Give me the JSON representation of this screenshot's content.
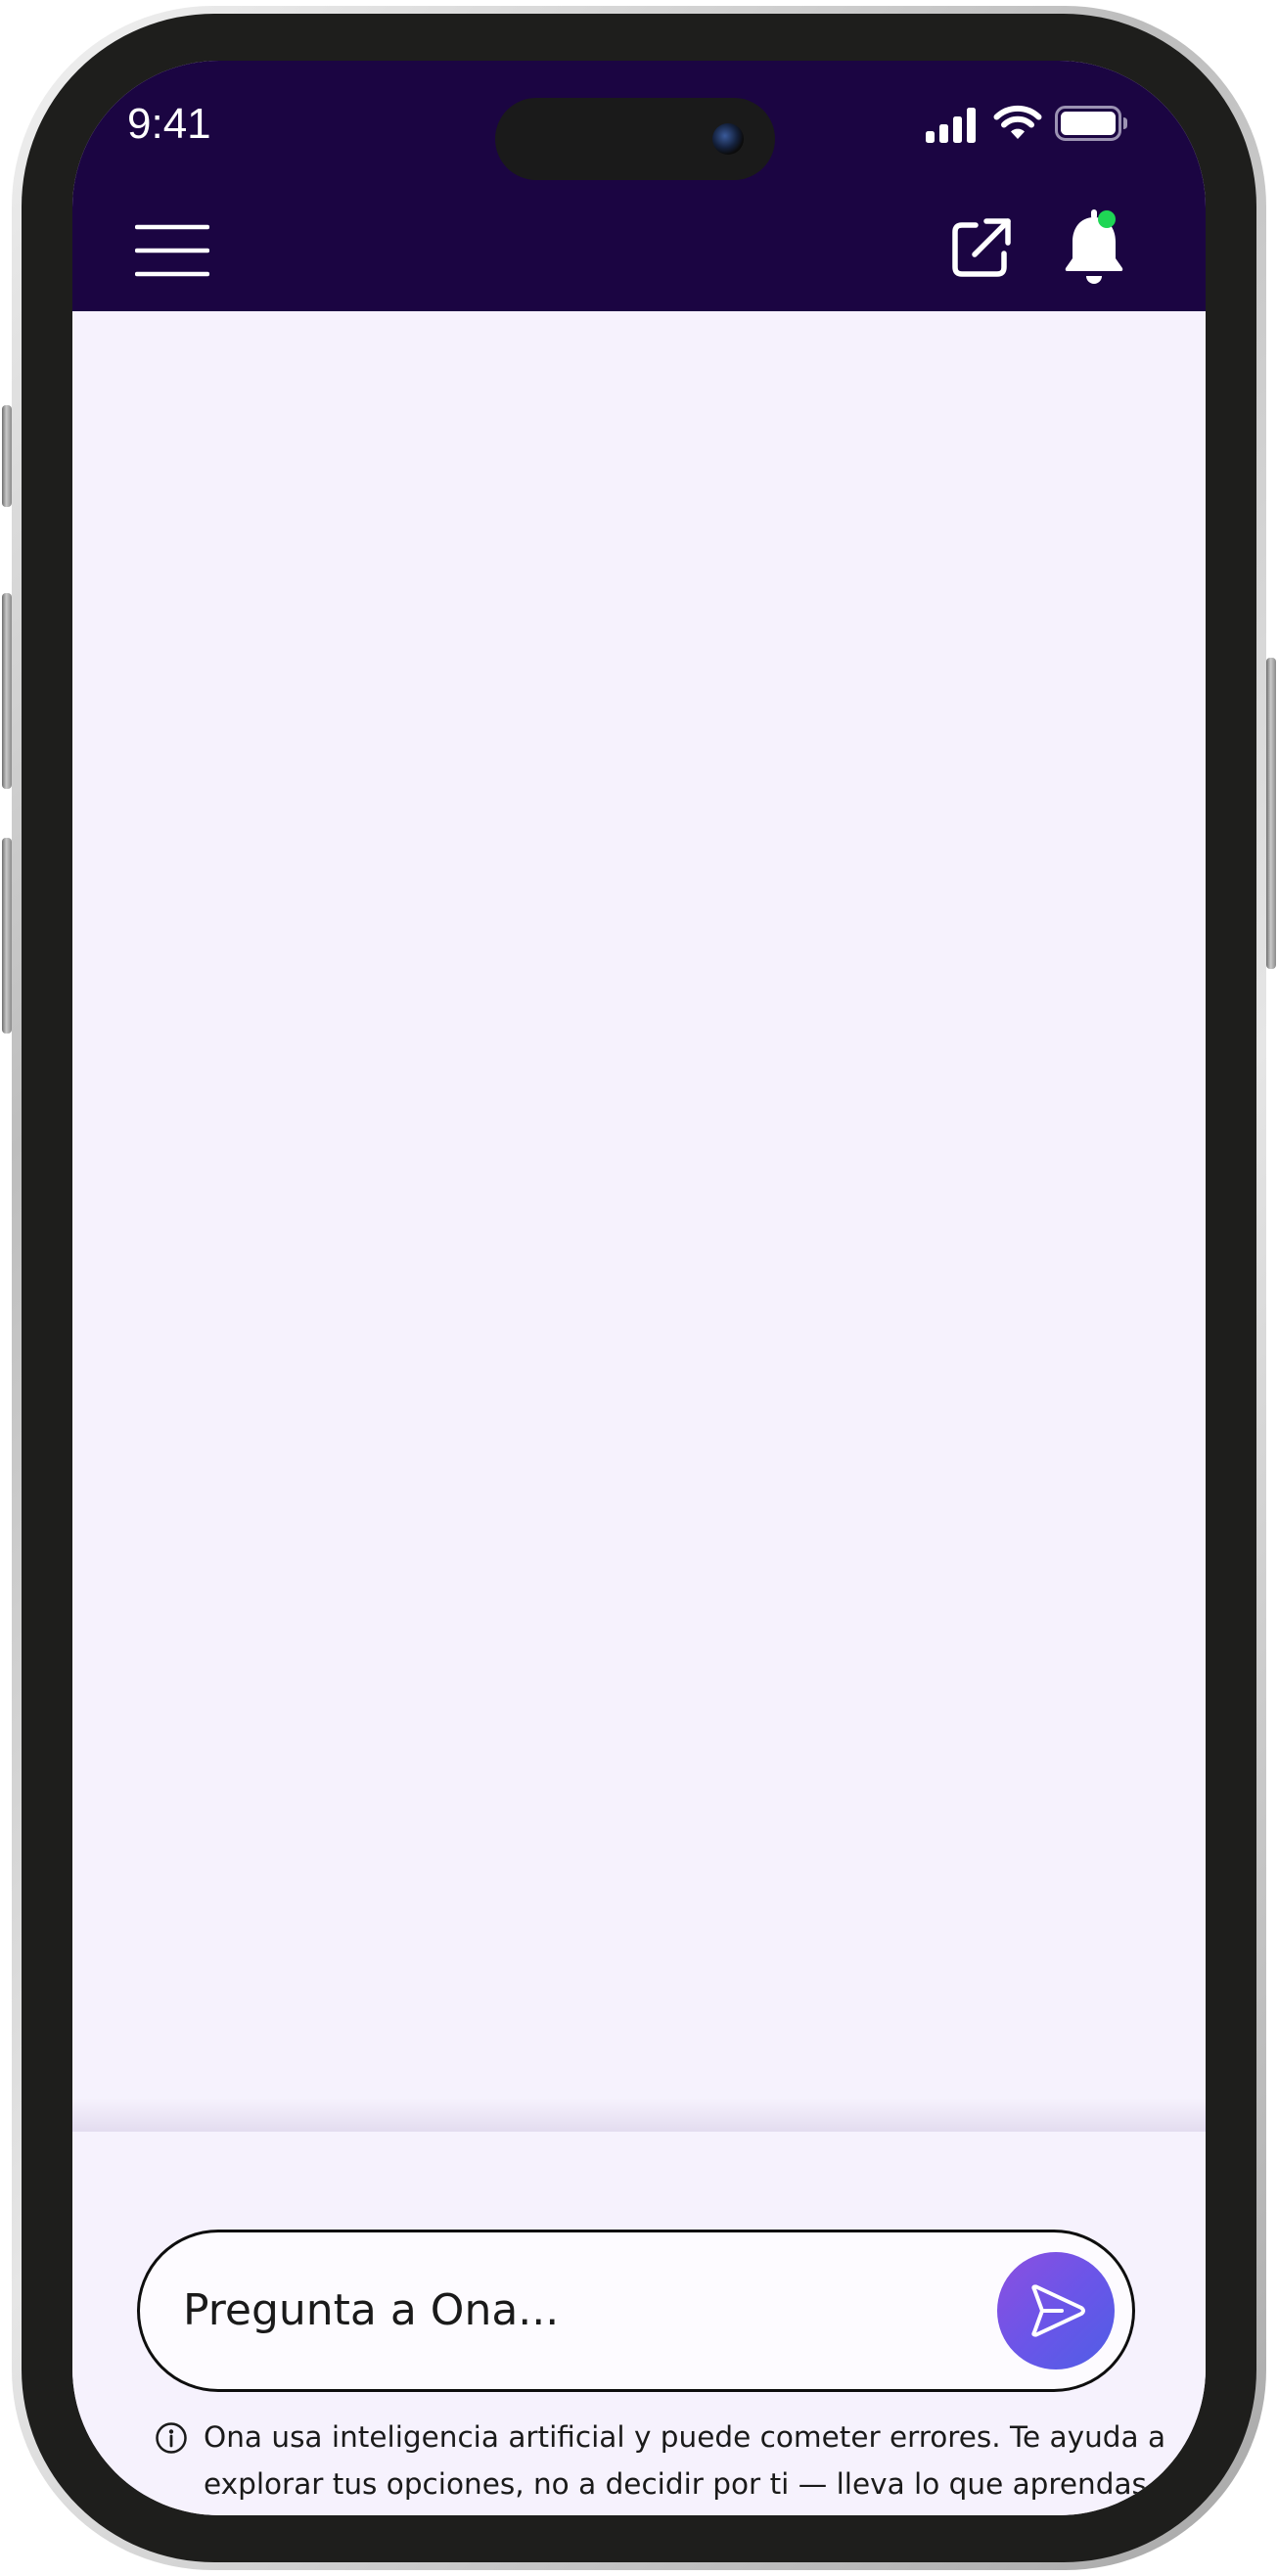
{
  "status_bar": {
    "time": "9:41",
    "icons": [
      "cellular-signal-icon",
      "wifi-icon",
      "battery-icon"
    ]
  },
  "header": {
    "background_color": "#1b0542",
    "menu_icon": "hamburger-menu-icon",
    "actions": [
      {
        "name": "external-link-icon"
      },
      {
        "name": "bell-icon",
        "has_notification": true,
        "badge_color": "#1fd655"
      }
    ]
  },
  "chat": {
    "input_placeholder": "Pregunta a Ona...",
    "send_icon": "send-icon",
    "send_gradient": [
      "#8c4fe0",
      "#4f5ee6"
    ]
  },
  "disclaimer": {
    "icon": "info-icon",
    "text": "Ona usa inteligencia artificial y puede cometer errores. Te ayuda a explorar tus opciones, no a decidir por ti — lleva lo que aprendas a tus asesores financieros, legales y fiscales."
  },
  "theme": {
    "screen_background": "#f6f2fd"
  }
}
